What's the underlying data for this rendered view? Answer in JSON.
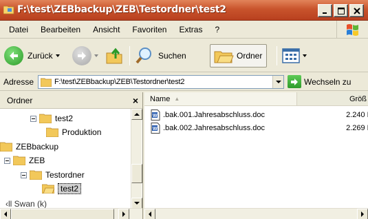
{
  "window": {
    "title": "F:\\test\\ZEBbackup\\ZEB\\Testordner\\test2"
  },
  "menu": [
    "Datei",
    "Bearbeiten",
    "Ansicht",
    "Favoriten",
    "Extras",
    "?"
  ],
  "toolbar": {
    "back_label": "Zurück",
    "search_label": "Suchen",
    "folders_label": "Ordner"
  },
  "address": {
    "label": "Adresse",
    "value": "F:\\test\\ZEBbackup\\ZEB\\Testordner\\test2",
    "go_label": "Wechseln zu"
  },
  "folder_pane": {
    "header": "Ordner",
    "close": "×",
    "tree": [
      {
        "label": "test2",
        "level": 2,
        "expander": true
      },
      {
        "label": "Produktion",
        "level": 3,
        "expander": false
      },
      {
        "label": "ZEBbackup",
        "level": 0,
        "expander": false
      },
      {
        "label": "ZEB",
        "level": 1,
        "expander": true
      },
      {
        "label": "Testordner",
        "level": 2,
        "expander": true
      },
      {
        "label": "test2",
        "level": 3,
        "expander": false,
        "selected": true
      },
      {
        "label": "...",
        "level": 0,
        "partial": true
      }
    ],
    "partial_text": "‹ll Swan (k)"
  },
  "file_list": {
    "columns": {
      "name": "Name",
      "size": "Größ"
    },
    "files": [
      {
        "name": ".bak.001.Jahresabschluss.doc",
        "size": "2.240 K"
      },
      {
        "name": ".bak.002.Jahresabschluss.doc",
        "size": "2.269 K"
      }
    ]
  },
  "colors": {
    "titlebar": "#c9542c",
    "folder": "#f0c75a",
    "go_arrow": "#2e9b2a"
  }
}
